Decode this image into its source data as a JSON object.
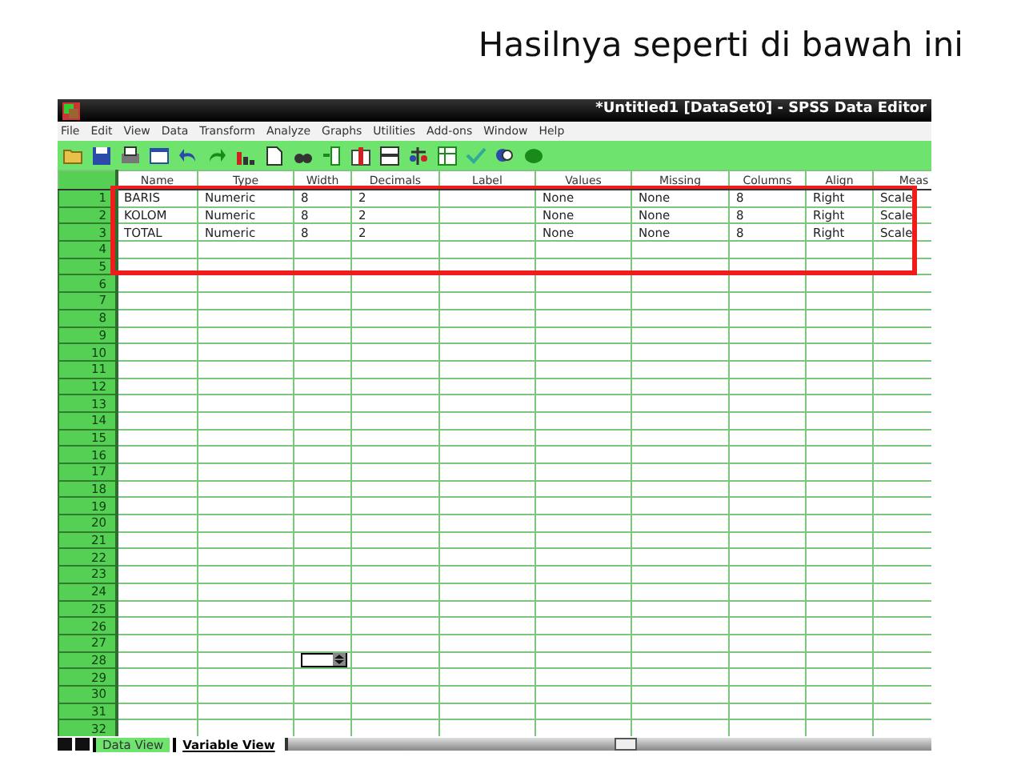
{
  "slide_title": "Hasilnya seperti di bawah ini",
  "window": {
    "title": "*Untitled1 [DataSet0] - SPSS Data Editor"
  },
  "menu": [
    "File",
    "Edit",
    "View",
    "Data",
    "Transform",
    "Analyze",
    "Graphs",
    "Utilities",
    "Add-ons",
    "Window",
    "Help"
  ],
  "columns": [
    {
      "label": "Name"
    },
    {
      "label": "Type"
    },
    {
      "label": "Width"
    },
    {
      "label": "Decimals"
    },
    {
      "label": "Label"
    },
    {
      "label": "Values"
    },
    {
      "label": "Missing"
    },
    {
      "label": "Columns"
    },
    {
      "label": "Align"
    },
    {
      "label": "Meas"
    }
  ],
  "rows": [
    {
      "number": "1",
      "cells": [
        "BARIS",
        "Numeric",
        "8",
        "2",
        null,
        "None",
        "None",
        "8",
        "Right",
        "Scale"
      ]
    },
    {
      "number": "2",
      "cells": [
        "KOLOM",
        "Numeric",
        "8",
        "2",
        null,
        "None",
        "None",
        "8",
        "Right",
        "Scale"
      ]
    },
    {
      "number": "3",
      "cells": [
        "TOTAL",
        "Numeric",
        "8",
        "2",
        null,
        "None",
        "None",
        "8",
        "Right",
        "Scale"
      ]
    },
    {
      "number": "4"
    },
    {
      "number": "5"
    },
    {
      "number": "6"
    },
    {
      "number": "7"
    },
    {
      "number": "8"
    },
    {
      "number": "9"
    },
    {
      "number": "10"
    },
    {
      "number": "11"
    },
    {
      "number": "12"
    },
    {
      "number": "13"
    },
    {
      "number": "14"
    },
    {
      "number": "15"
    },
    {
      "number": "16"
    },
    {
      "number": "17"
    },
    {
      "number": "18"
    },
    {
      "number": "19"
    },
    {
      "number": "20"
    },
    {
      "number": "21"
    },
    {
      "number": "22"
    },
    {
      "number": "23"
    },
    {
      "number": "24"
    },
    {
      "number": "25"
    },
    {
      "number": "26"
    },
    {
      "number": "27"
    },
    {
      "number": "28",
      "cells": [
        null,
        null,
        {
          "kind": "editor"
        },
        null,
        null,
        null,
        null,
        null,
        null,
        null
      ]
    },
    {
      "number": "29"
    },
    {
      "number": "30"
    },
    {
      "number": "31"
    },
    {
      "number": "32"
    }
  ],
  "tabs": [
    {
      "label": "Data View",
      "selected": true
    },
    {
      "label": "Variable View",
      "selected": false
    }
  ]
}
